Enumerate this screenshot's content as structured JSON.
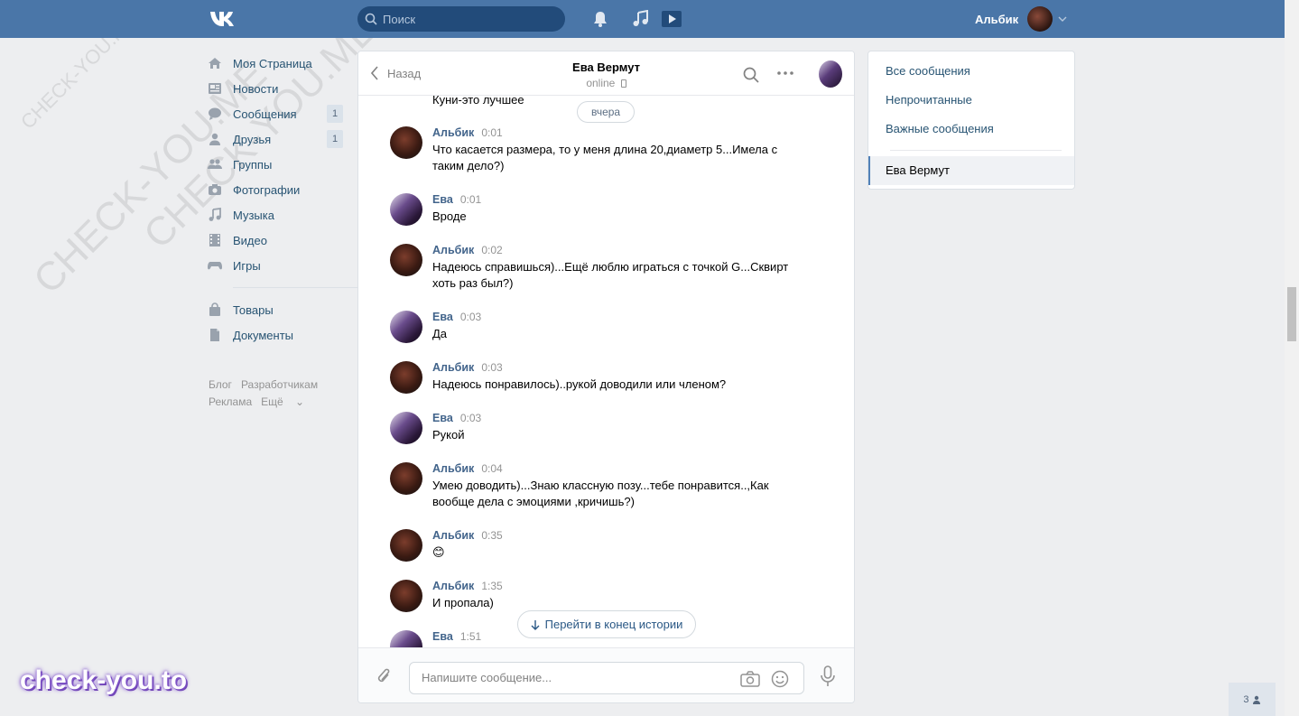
{
  "topbar": {
    "search_placeholder": "Поиск",
    "user_name": "Альбик",
    "icons": [
      "vk-logo-icon",
      "search-icon",
      "bell-icon",
      "music-note-icon",
      "play-icon",
      "chevron-down-icon"
    ]
  },
  "watermark": {
    "diagonal_1": "CHECK-YOU.ME",
    "diagonal_2": "CHECK-YOU.ME",
    "diagonal_3": "CHECK-YOU.ME",
    "bottom": "check-you.to"
  },
  "left_menu": {
    "items": [
      {
        "label": "Моя Страница",
        "icon": "home-icon"
      },
      {
        "label": "Новости",
        "icon": "news-icon"
      },
      {
        "label": "Сообщения",
        "icon": "chat-icon",
        "count": "1"
      },
      {
        "label": "Друзья",
        "icon": "person-icon",
        "count": "1"
      },
      {
        "label": "Группы",
        "icon": "group-icon"
      },
      {
        "label": "Фотографии",
        "icon": "camera-icon"
      },
      {
        "label": "Музыка",
        "icon": "music-icon"
      },
      {
        "label": "Видео",
        "icon": "film-icon"
      },
      {
        "label": "Игры",
        "icon": "gamepad-icon"
      }
    ],
    "items2": [
      {
        "label": "Товары",
        "icon": "bag-icon"
      },
      {
        "label": "Документы",
        "icon": "document-icon"
      }
    ],
    "footer": {
      "blog": "Блог",
      "dev": "Разработчикам",
      "ads": "Реклама",
      "more": "Ещё"
    }
  },
  "chat": {
    "back_label": "Назад",
    "title": "Ева Вермут",
    "status": "online",
    "date_pill": "вчера",
    "prev_text": "Куни-это лучшее",
    "messages": [
      {
        "author": "Альбик",
        "time": "0:01",
        "text": "Что касается размера, то у меня длина 20,диаметр 5...Имела с таким дело?)",
        "who": "alb"
      },
      {
        "author": "Ева",
        "time": "0:01",
        "text": "Вроде",
        "who": "eva"
      },
      {
        "author": "Альбик",
        "time": "0:02",
        "text": "Надеюсь справишься)...Ещё люблю играться с точкой G...Сквирт хоть раз был?)",
        "who": "alb"
      },
      {
        "author": "Ева",
        "time": "0:03",
        "text": "Да",
        "who": "eva"
      },
      {
        "author": "Альбик",
        "time": "0:03",
        "text": "Надеюсь понравилось)..рукой доводили или членом?",
        "who": "alb"
      },
      {
        "author": "Ева",
        "time": "0:03",
        "text": "Рукой",
        "who": "eva"
      },
      {
        "author": "Альбик",
        "time": "0:04",
        "text": "Умею доводить)...Знаю классную позу...тебе понравится..,Как вообще дела с эмоциями ,кричишь?)",
        "who": "alb"
      },
      {
        "author": "Альбик",
        "time": "0:35",
        "text": "😊",
        "who": "alb"
      },
      {
        "author": "Альбик",
        "time": "1:35",
        "text": "И пропала)",
        "who": "alb"
      },
      {
        "author": "Ева",
        "time": "1:51",
        "text": "",
        "who": "eva"
      }
    ],
    "jump_label": "Перейти в конец истории",
    "input_placeholder": "Напишите сообщение..."
  },
  "right_panel": {
    "all": "Все сообщения",
    "unread": "Непрочитанные",
    "important": "Важные сообщения",
    "active_dialog": "Ева Вермут"
  },
  "online_count": "3",
  "colors": {
    "header": "#4a76a8",
    "link": "#2a5885",
    "author": "#42648b"
  }
}
